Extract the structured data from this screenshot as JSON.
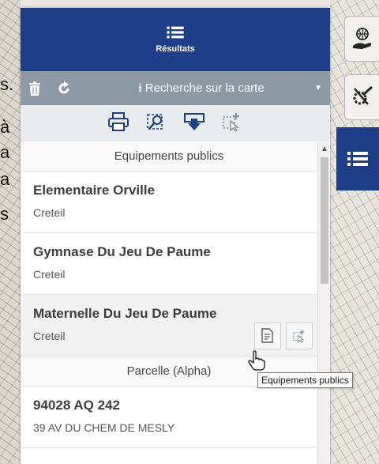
{
  "header": {
    "title": "Résultats"
  },
  "toolbar": {
    "search_label": "Recherche sur la carte"
  },
  "map": {
    "left_text": [
      "s.",
      "à",
      "a",
      "a",
      "s"
    ]
  },
  "groups": [
    {
      "title": "Equipements publics",
      "items": [
        {
          "name": "Elementaire Orville",
          "sub": "Creteil"
        },
        {
          "name": "Gymnase Du Jeu De Paume",
          "sub": "Creteil"
        },
        {
          "name": "Maternelle Du Jeu De Paume",
          "sub": "Creteil"
        }
      ]
    },
    {
      "title": "Parcelle (Alpha)",
      "items": [
        {
          "name": "94028 AQ 242",
          "sub": "39 AV DU CHEM DE MESLY"
        }
      ]
    }
  ],
  "tooltip": "Equipements publics",
  "colors": {
    "primary": "#1e3f88",
    "toolbar": "#8d9aa5",
    "iconbar": "#e8ecef"
  },
  "icons": [
    "list-icon",
    "trash-icon",
    "refresh-icon",
    "info-icon",
    "caret-down-icon",
    "print-icon",
    "zoom-to-icon",
    "download-icon",
    "edit-select-icon",
    "globe-hand-icon",
    "tools-icon"
  ]
}
